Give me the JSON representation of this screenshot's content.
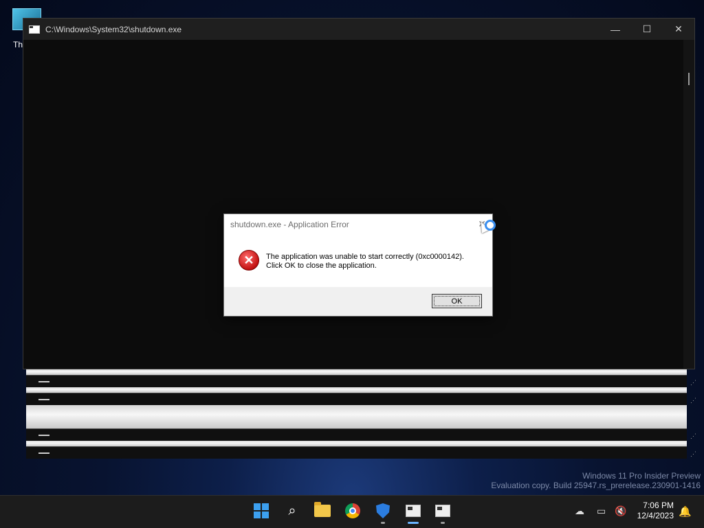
{
  "desktop": {
    "icon_label": "Th"
  },
  "console_window": {
    "title": "C:\\Windows\\System32\\shutdown.exe",
    "minimize_glyph": "—",
    "maximize_glyph": "☐",
    "close_glyph": "✕"
  },
  "dialog": {
    "title": "shutdown.exe - Application Error",
    "close_glyph": "✕",
    "icon": "error-icon",
    "message_line1": "The application was unable to start correctly (0xc0000142).",
    "message_line2": "Click OK to close the application.",
    "ok_label": "OK"
  },
  "watermark": {
    "line1": "Windows 11 Pro Insider Preview",
    "line2": "Evaluation copy. Build 25947.rs_prerelease.230901-1416"
  },
  "taskbar": {
    "apps": [
      "start",
      "search",
      "file-explorer",
      "chrome",
      "windows-security",
      "console-1",
      "console-2"
    ],
    "time": "7:06 PM",
    "date": "12/4/2023"
  },
  "colors": {
    "accent": "#3ca0f0",
    "error": "#c31212",
    "console_bg": "#0c0c0c"
  }
}
